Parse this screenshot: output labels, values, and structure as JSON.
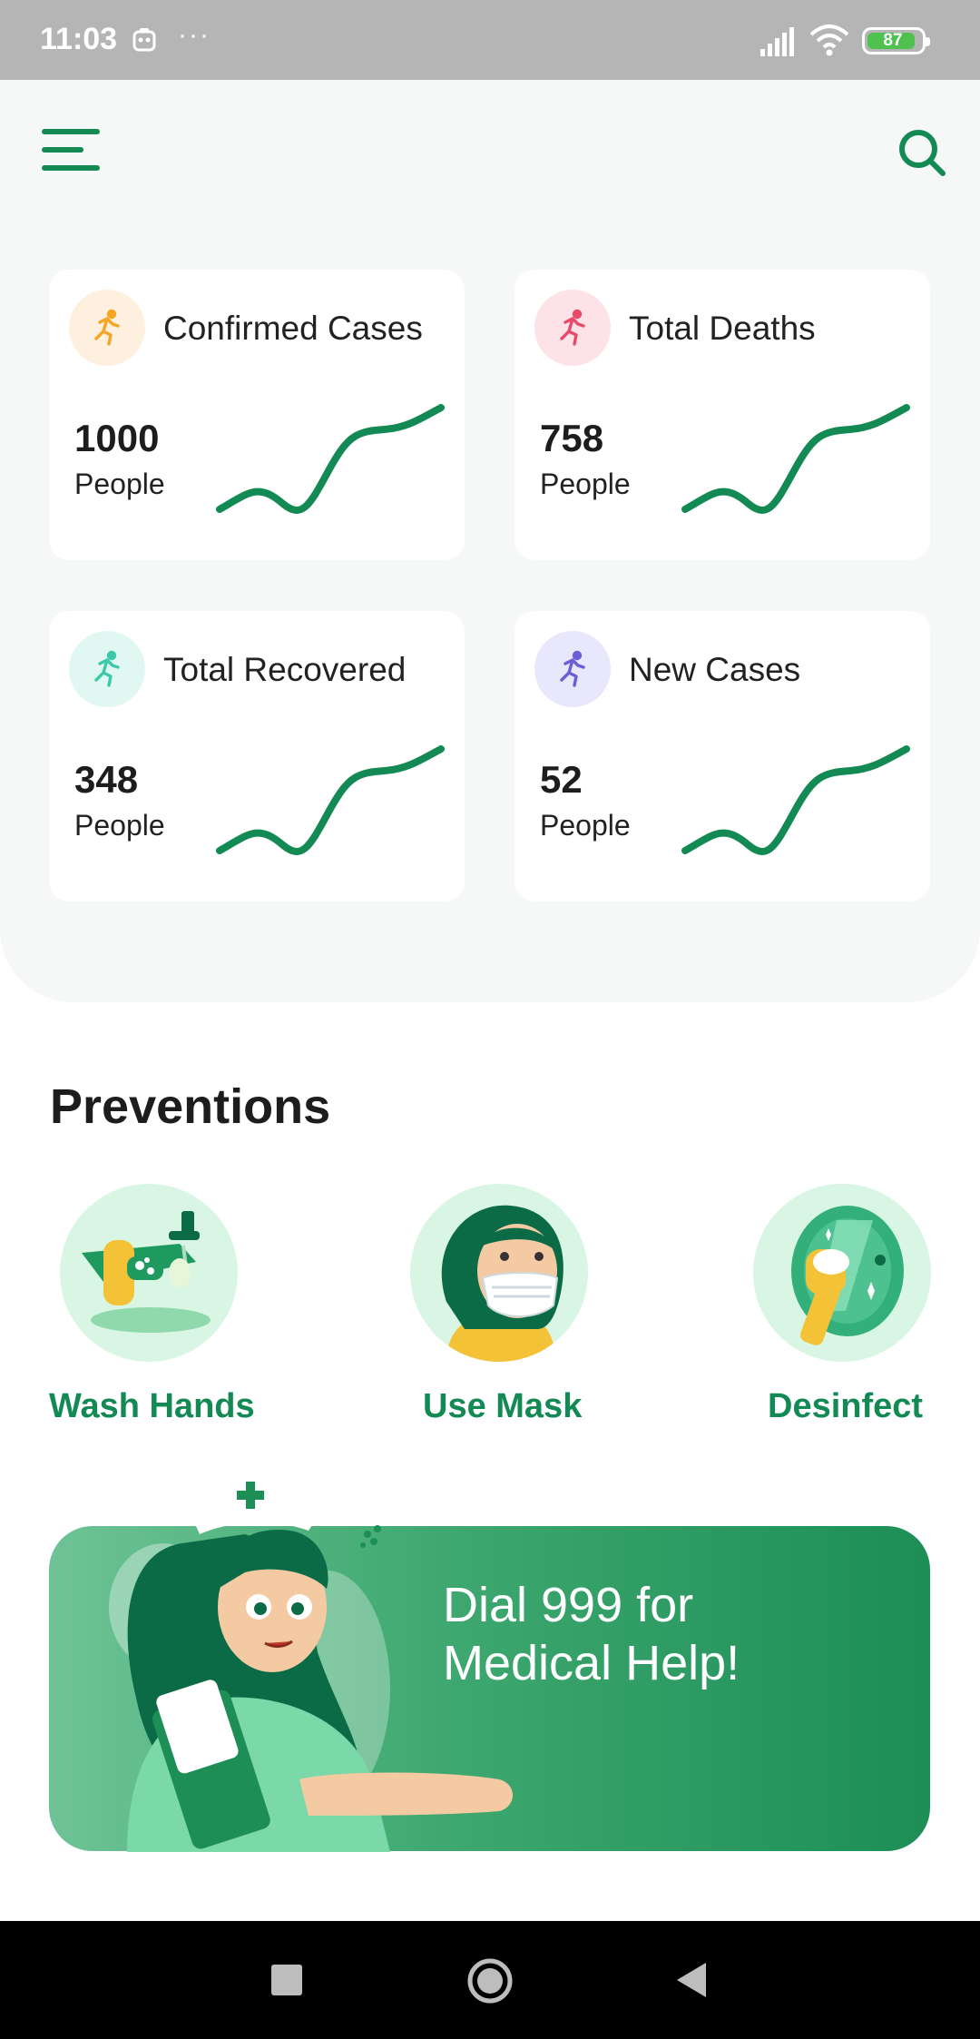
{
  "status_bar": {
    "time": "11:03",
    "more": "···",
    "battery": "87"
  },
  "colors": {
    "brand_green": "#138954",
    "panel_bg": "#f6f7f7",
    "orange_accent": "#f5a524",
    "red_accent": "#e84a6a",
    "teal_accent": "#3cc9a9",
    "purple_accent": "#6a5fd6"
  },
  "header": {
    "menu_icon": "menu-icon",
    "search_icon": "search-icon"
  },
  "stats": [
    {
      "title": "Confirmed Cases",
      "value": "1000",
      "unit": "People",
      "icon": "running-person-icon",
      "icon_color": "#f5a524",
      "icon_bg": "#fdf0df"
    },
    {
      "title": "Total Deaths",
      "value": "758",
      "unit": "People",
      "icon": "running-person-icon",
      "icon_color": "#e84a6a",
      "icon_bg": "#fde3e7"
    },
    {
      "title": "Total Recovered",
      "value": "348",
      "unit": "People",
      "icon": "running-person-icon",
      "icon_color": "#3cc9a9",
      "icon_bg": "#e1f8f2"
    },
    {
      "title": "New Cases",
      "value": "52",
      "unit": "People",
      "icon": "running-person-icon",
      "icon_color": "#6a5fd6",
      "icon_bg": "#e9e7fb"
    }
  ],
  "preventions": {
    "heading": "Preventions",
    "items": [
      {
        "label": "Wash Hands",
        "icon": "wash-hands-illustration"
      },
      {
        "label": "Use Mask",
        "icon": "mask-illustration"
      },
      {
        "label": "Desinfect",
        "icon": "disinfect-illustration"
      }
    ]
  },
  "banner": {
    "line1": "Dial 999 for",
    "line2": "Medical Help!",
    "illustration": "nurse-illustration"
  },
  "nav": {
    "recents": "recents-icon",
    "home": "home-icon",
    "back": "back-icon"
  }
}
